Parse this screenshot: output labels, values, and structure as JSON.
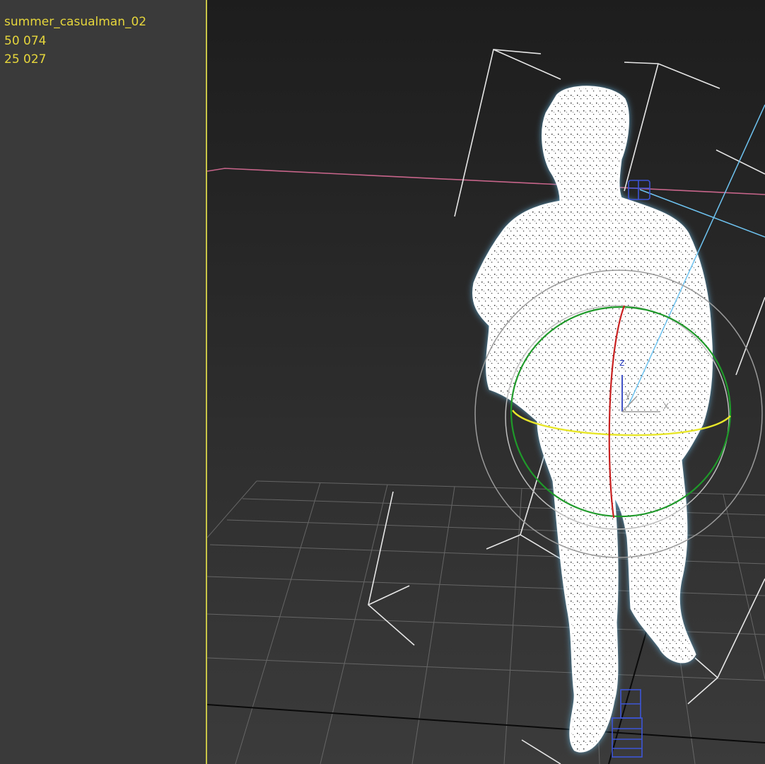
{
  "stats": {
    "object_name": "summer_casualman_02",
    "polygons": "50 074",
    "vertices": "25 027"
  },
  "gizmo": {
    "z_label": "z",
    "y_label": "y",
    "x_label": "x"
  },
  "colors": {
    "stats_text": "#e6d63c",
    "active_border": "#c8c447",
    "gizmo_green": "#1f9a2a",
    "gizmo_yellow": "#e8e62a",
    "gizmo_red": "#c82020",
    "bone_blue": "#3d55d6",
    "selection_cyan": "#6ec3f0"
  }
}
